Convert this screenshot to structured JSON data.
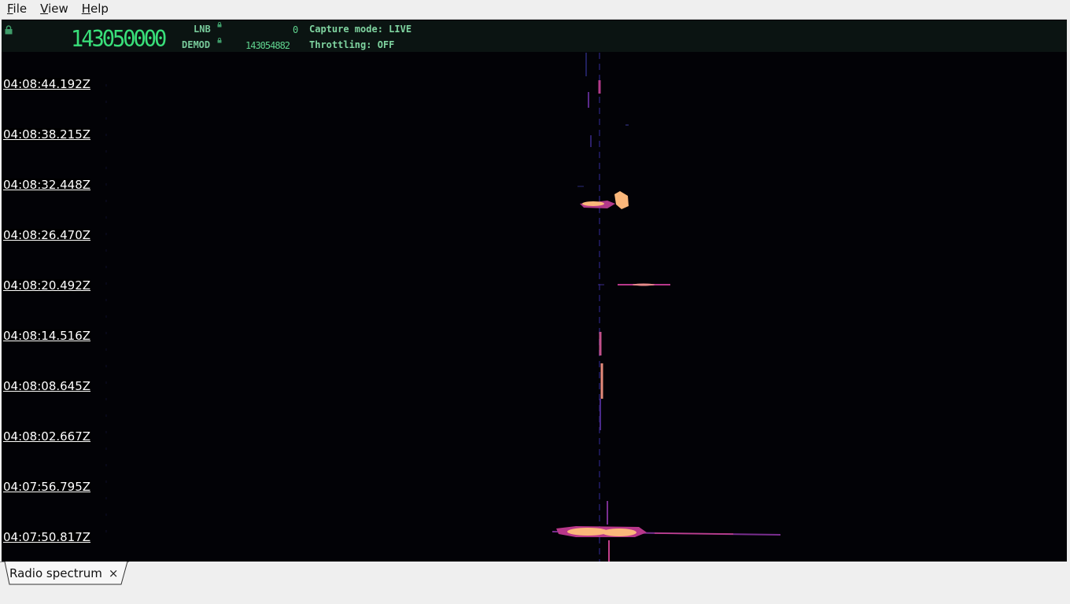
{
  "menu": {
    "items": [
      {
        "label": "File",
        "mnemonic": "F"
      },
      {
        "label": "View",
        "mnemonic": "V"
      },
      {
        "label": "Help",
        "mnemonic": "H"
      }
    ]
  },
  "header": {
    "main_frequency": "143050000",
    "lnb_label": "LNB",
    "lnb_value": "0",
    "demod_label": "DEMOD",
    "demod_value": "143054882",
    "capture_mode": "Capture mode: LIVE",
    "throttling": "Throttling: OFF",
    "icons": [
      "lock-icon",
      "lock-icon",
      "lock-icon"
    ]
  },
  "waterfall": {
    "timestamps": [
      "04:08:44.192Z",
      "04:08:38.215Z",
      "04:08:32.448Z",
      "04:08:26.470Z",
      "04:08:20.492Z",
      "04:08:14.516Z",
      "04:08:08.645Z",
      "04:08:02.667Z",
      "04:07:56.795Z",
      "04:07:50.817Z"
    ],
    "colors": {
      "background": "#020206",
      "low": "#2b1a6b",
      "mid": "#b8378a",
      "high": "#fbb77a"
    }
  },
  "tabs": [
    {
      "label": "Radio spectrum",
      "close": "×"
    }
  ]
}
